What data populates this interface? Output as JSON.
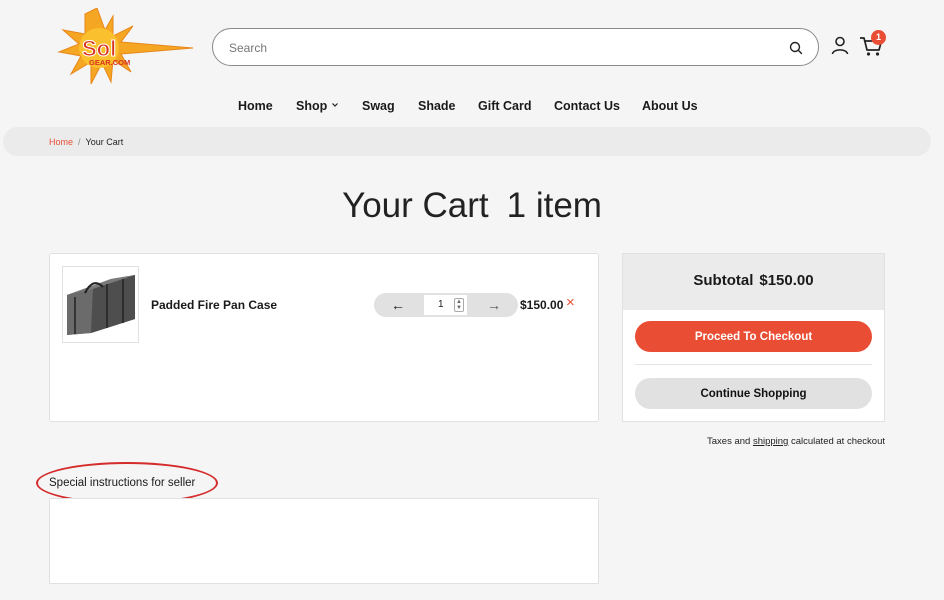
{
  "header": {
    "logo_text": "Sol",
    "logo_subtext": "GEAR.COM",
    "search_placeholder": "Search",
    "icons": {
      "search": "search-icon",
      "account": "user-icon",
      "cart": "cart-icon"
    },
    "cart_count": "1"
  },
  "nav": {
    "items": [
      "Home",
      "Shop",
      "Swag",
      "Shade",
      "Gift Card",
      "Contact Us",
      "About Us"
    ]
  },
  "breadcrumb": {
    "home": "Home",
    "separator": "/",
    "current": "Your Cart"
  },
  "page": {
    "title": "Your Cart",
    "item_count": "1 item"
  },
  "cart": {
    "items": [
      {
        "name": "Padded Fire Pan Case",
        "quantity": "1",
        "price": "$150.00"
      }
    ],
    "remove_icon": "×"
  },
  "summary": {
    "subtotal_label": "Subtotal",
    "subtotal_value": "$150.00",
    "checkout_label": "Proceed To Checkout",
    "continue_label": "Continue Shopping",
    "taxes_pre": "Taxes and ",
    "taxes_link": "shipping",
    "taxes_post": " calculated at checkout"
  },
  "instructions": {
    "label": "Special instructions for seller",
    "value": ""
  },
  "colors": {
    "accent": "#e94e35",
    "annotation": "#d42b2b"
  }
}
